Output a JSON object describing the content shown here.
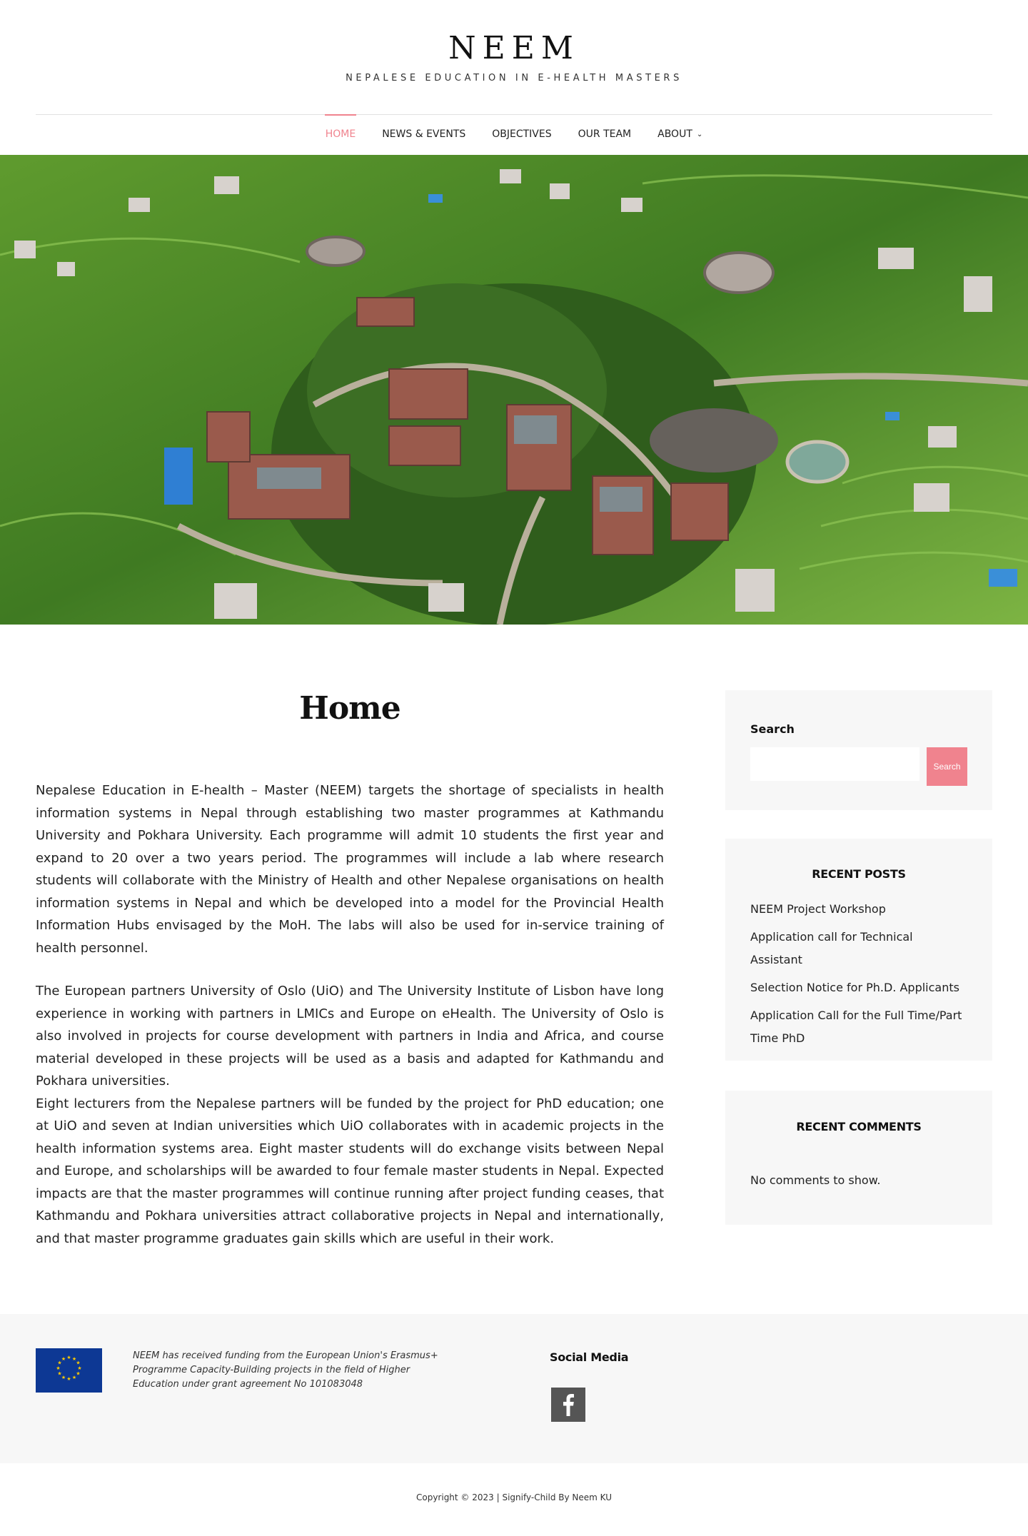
{
  "site": {
    "title": "NEEM",
    "tagline": "Nepalese Education in e-Health Masters"
  },
  "nav": {
    "items": [
      {
        "label": "Home",
        "active": true
      },
      {
        "label": "News & Events"
      },
      {
        "label": "Objectives"
      },
      {
        "label": "Our Team"
      },
      {
        "label": "About",
        "icon": "chevron-down-icon"
      }
    ]
  },
  "hero": {
    "image": "aerial-campus-photo"
  },
  "main": {
    "title": "Home",
    "paragraphs": [
      "Nepalese Education in E-health – Master (NEEM) targets the shortage of specialists in health information systems in Nepal through establishing two master programmes at Kathmandu University and Pokhara University. Each programme will admit 10 students the first year and expand to 20 over a two years period. The programmes will include a lab where research students will collaborate with the Ministry of Health and other Nepalese organisations on health information systems in Nepal and which be developed into a model for the Provincial Health Information Hubs envisaged by the MoH. The labs will also be used for in-service training of health personnel.",
      "The European partners University of Oslo (UiO) and The University Institute of Lisbon have long experience in working with partners in LMICs and Europe on eHealth. The University of Oslo is also involved in projects for course development with partners in India and Africa, and course material developed in these projects will be used as a basis and adapted for Kathmandu and Pokhara universities.",
      "Eight lecturers from the Nepalese partners will be funded by the project for PhD education; one at UiO and seven at Indian universities which UiO collaborates with in academic projects in the health information systems area. Eight master students will do exchange visits between Nepal and Europe, and scholarships will be awarded to four female master students in Nepal. Expected impacts are that the master programmes will continue running after project funding ceases, that Kathmandu and Pokhara universities attract collaborative projects in Nepal and internationally, and that master programme graduates gain skills which are useful in their work."
    ]
  },
  "sidebar": {
    "search": {
      "label": "Search",
      "placeholder": "",
      "button": "Search"
    },
    "recent_posts": {
      "title": "Recent Posts",
      "items": [
        "NEEM Project Workshop",
        "Application call for Technical Assistant",
        "Selection Notice for Ph.D. Applicants",
        "Application Call for the Full Time/Part Time PhD"
      ]
    },
    "recent_comments": {
      "title": "Recent Comments",
      "empty": "No comments to show."
    }
  },
  "footer": {
    "funding_text": "NEEM has received funding from the European Union's Erasmus+ Programme Capacity-Building projects in the field of Higher Education under grant agreement No 101083048",
    "social_title": "Social Media",
    "social_icons": [
      "facebook-icon"
    ],
    "copyright": "Copyright © 2023 | Signify-Child By Neem KU"
  },
  "colors": {
    "accent": "#f0838e",
    "eu_blue": "#0d3894",
    "eu_gold": "#ffcc00",
    "panel": "#f7f7f7"
  }
}
